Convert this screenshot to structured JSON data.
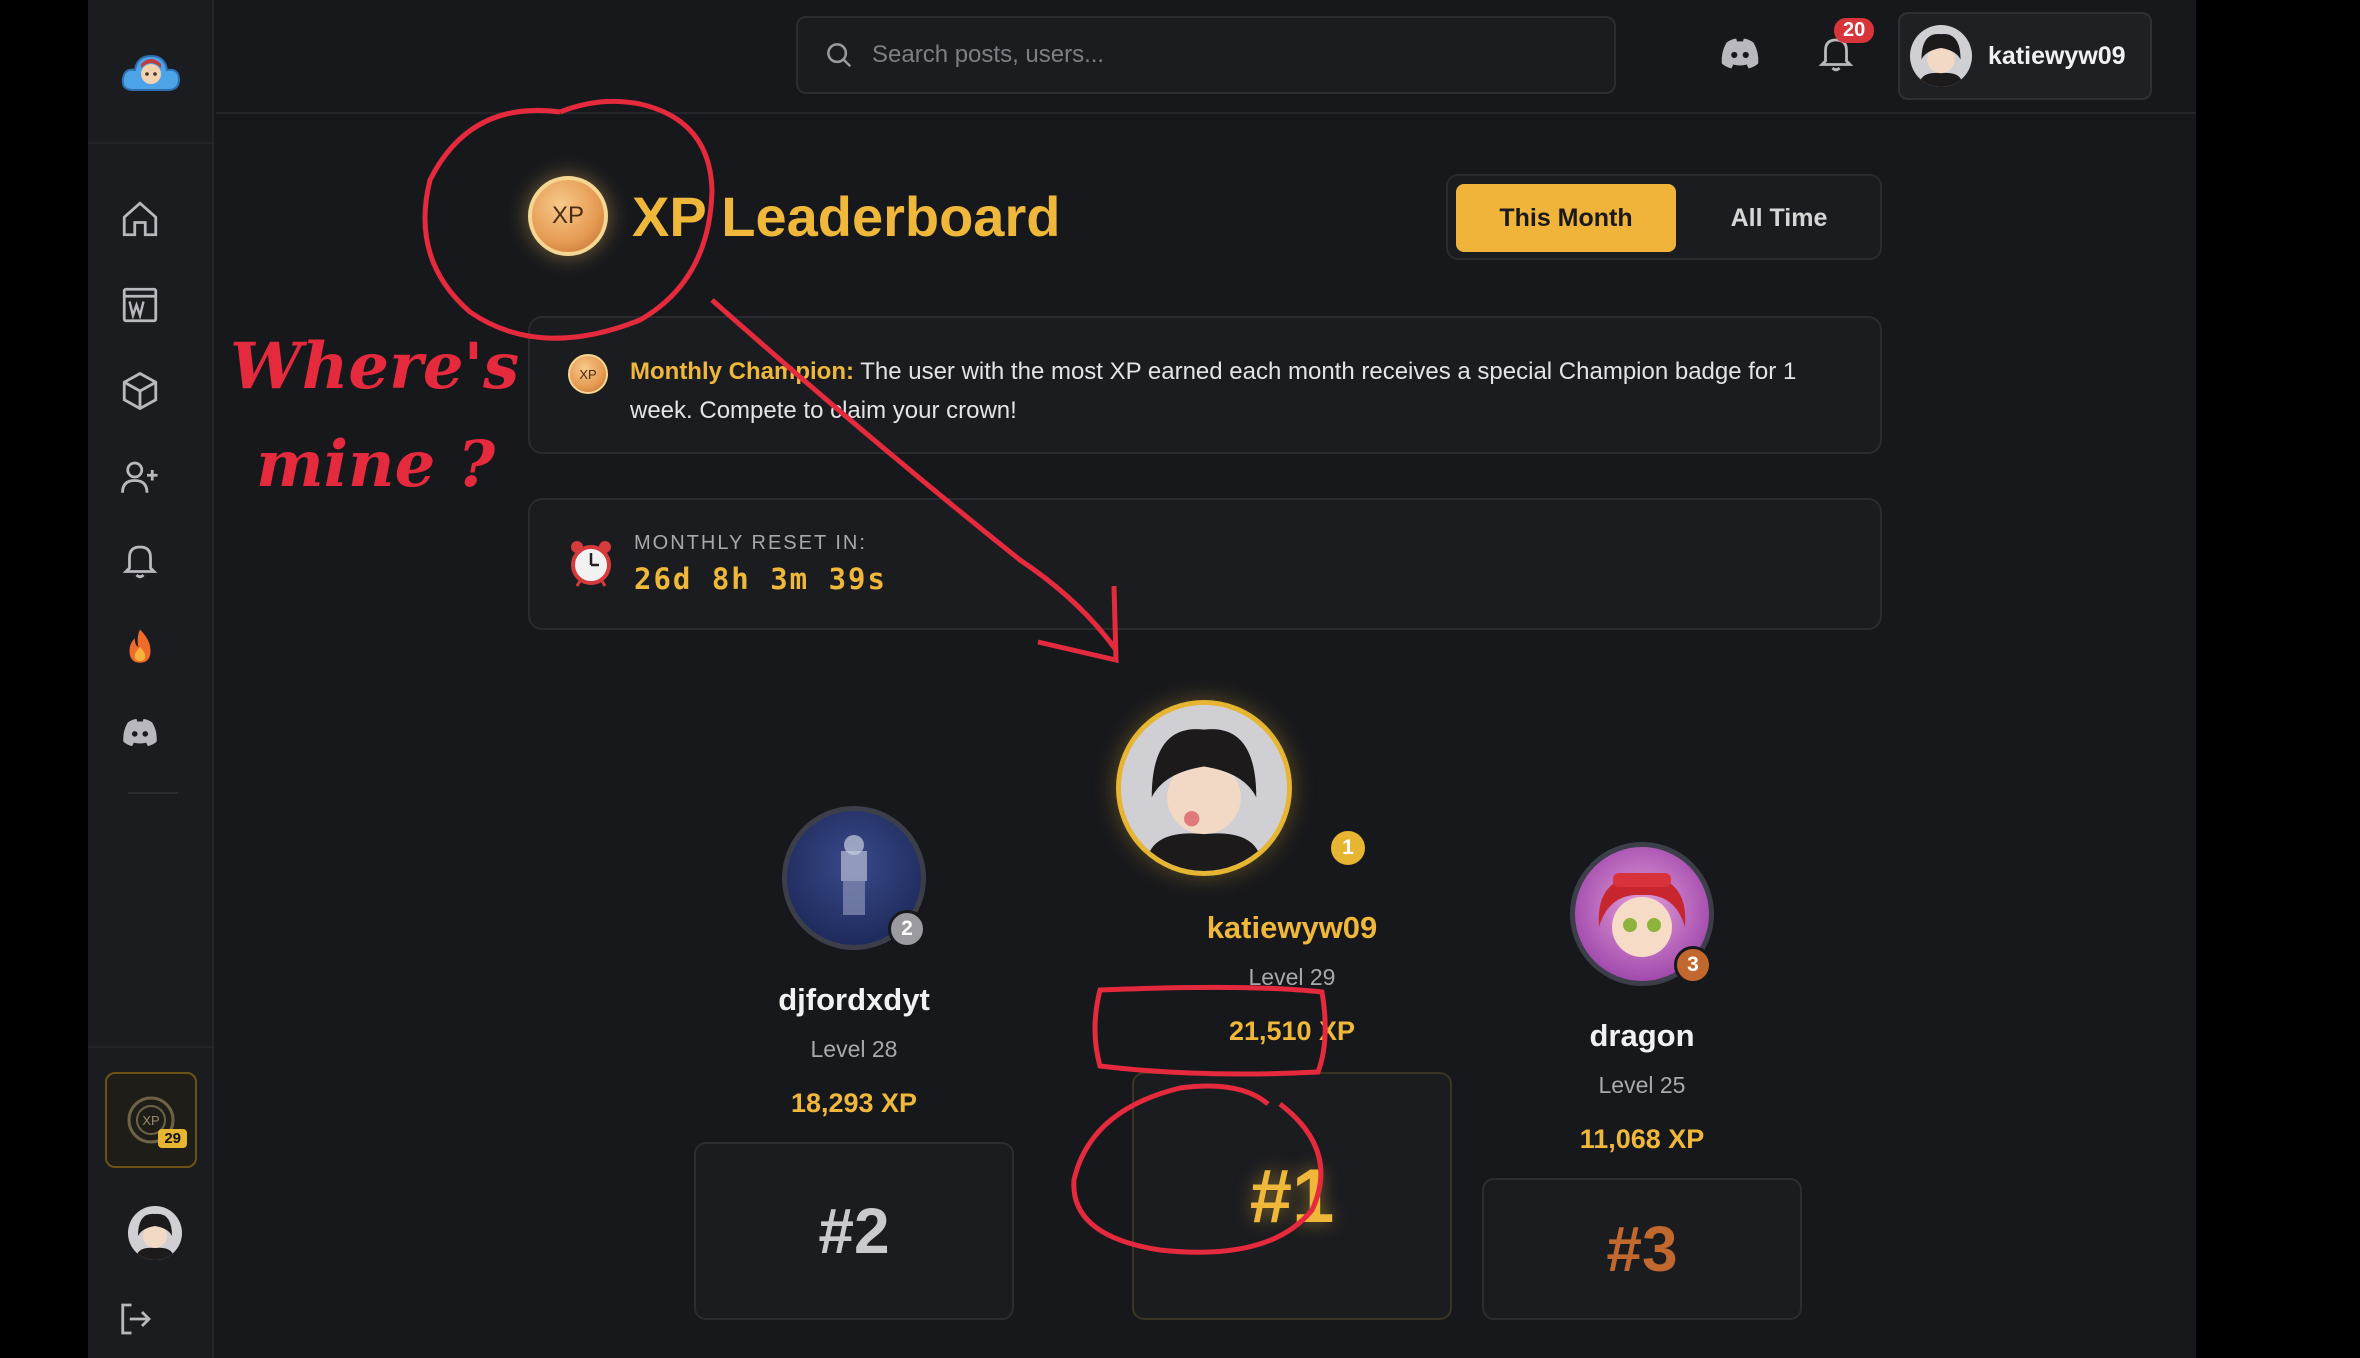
{
  "search": {
    "placeholder": "Search posts, users..."
  },
  "notifications": {
    "count": "20"
  },
  "user": {
    "username": "katiewyw09"
  },
  "sidebar": {
    "xp_level": "29"
  },
  "page": {
    "title": "XP Leaderboard",
    "coin_label": "XP",
    "tabs": [
      {
        "label": "This Month",
        "active": true
      },
      {
        "label": "All Time",
        "active": false
      }
    ]
  },
  "info": {
    "heading": "Monthly Champion:",
    "body": "The user with the most XP earned each month receives a special Champion badge for 1 week. Compete to claim your crown!"
  },
  "reset": {
    "label": "MONTHLY RESET IN:",
    "time": "26d 8h 3m 39s"
  },
  "podium": [
    {
      "rank": "1",
      "rank_label": "#1",
      "name": "katiewyw09",
      "level": "Level 29",
      "xp": "21,510 XP",
      "medal_color": "#e6b531"
    },
    {
      "rank": "2",
      "rank_label": "#2",
      "name": "djfordxdyt",
      "level": "Level 28",
      "xp": "18,293 XP",
      "medal_color": "#9a9aa0"
    },
    {
      "rank": "3",
      "rank_label": "#3",
      "name": "dragon",
      "level": "Level 25",
      "xp": "11,068 XP",
      "medal_color": "#c0682e"
    }
  ],
  "annotation": {
    "line1": "Where's",
    "line2": "mine ?",
    "color": "#e42a3c"
  },
  "colors": {
    "accent": "#f0b83a",
    "background": "#17181c",
    "panel": "#1b1c20"
  }
}
